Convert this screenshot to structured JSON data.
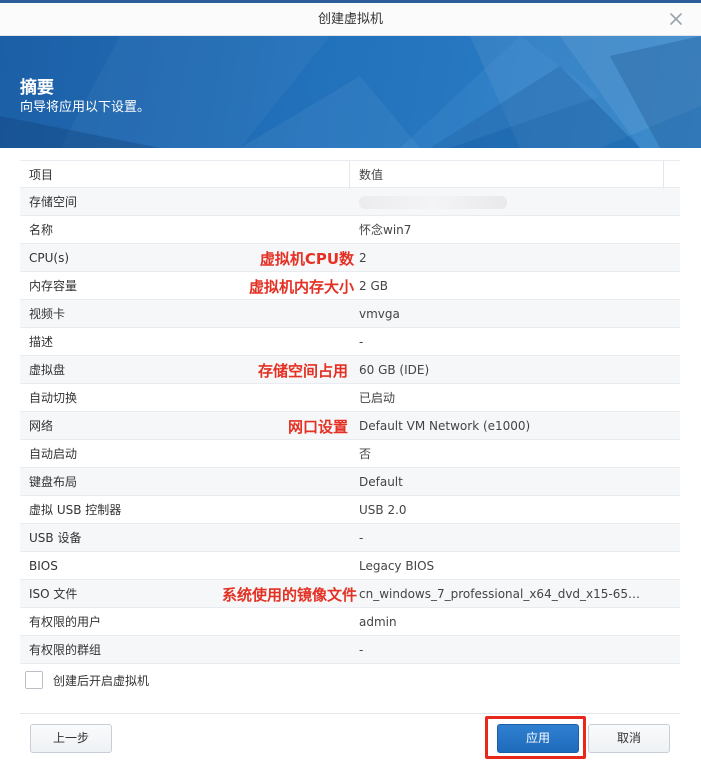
{
  "window": {
    "title": "创建虚拟机"
  },
  "banner": {
    "heading": "摘要",
    "subtitle": "向导将应用以下设置。"
  },
  "table": {
    "headers": {
      "key": "项目",
      "value": "数值"
    },
    "rows": [
      {
        "key": "存储空间",
        "value": ""
      },
      {
        "key": "名称",
        "value": "怀念win7"
      },
      {
        "key": "CPU(s)",
        "value": "2"
      },
      {
        "key": "内存容量",
        "value": "2 GB"
      },
      {
        "key": "视频卡",
        "value": "vmvga"
      },
      {
        "key": "描述",
        "value": "-"
      },
      {
        "key": "虚拟盘",
        "value": "60 GB (IDE)"
      },
      {
        "key": "自动切换",
        "value": "已启动"
      },
      {
        "key": "网络",
        "value": "Default VM Network (e1000)"
      },
      {
        "key": "自动启动",
        "value": "否"
      },
      {
        "key": "键盘布局",
        "value": "Default"
      },
      {
        "key": "虚拟 USB 控制器",
        "value": "USB 2.0"
      },
      {
        "key": "USB 设备",
        "value": "-"
      },
      {
        "key": "BIOS",
        "value": "Legacy BIOS"
      },
      {
        "key": "ISO 文件",
        "value": "cn_windows_7_professional_x64_dvd_x15-65…"
      },
      {
        "key": "有权限的用户",
        "value": "admin"
      },
      {
        "key": "有权限的群组",
        "value": "-"
      }
    ]
  },
  "annotations": {
    "cpu": "虚拟机CPU数",
    "memory": "虚拟机内存大小",
    "disk": "存储空间占用",
    "network": "网口设置",
    "iso": "系统使用的镜像文件"
  },
  "options": {
    "start_after_create": "创建后开启虚拟机",
    "start_after_create_checked": false
  },
  "buttons": {
    "prev": "上一步",
    "apply": "应用",
    "cancel": "取消"
  },
  "colors": {
    "accent": "#2271bb",
    "annotation": "#e43124",
    "highlight": "#e8281a"
  },
  "icons": {
    "close": "close-icon",
    "checkbox": "checkbox-icon"
  }
}
